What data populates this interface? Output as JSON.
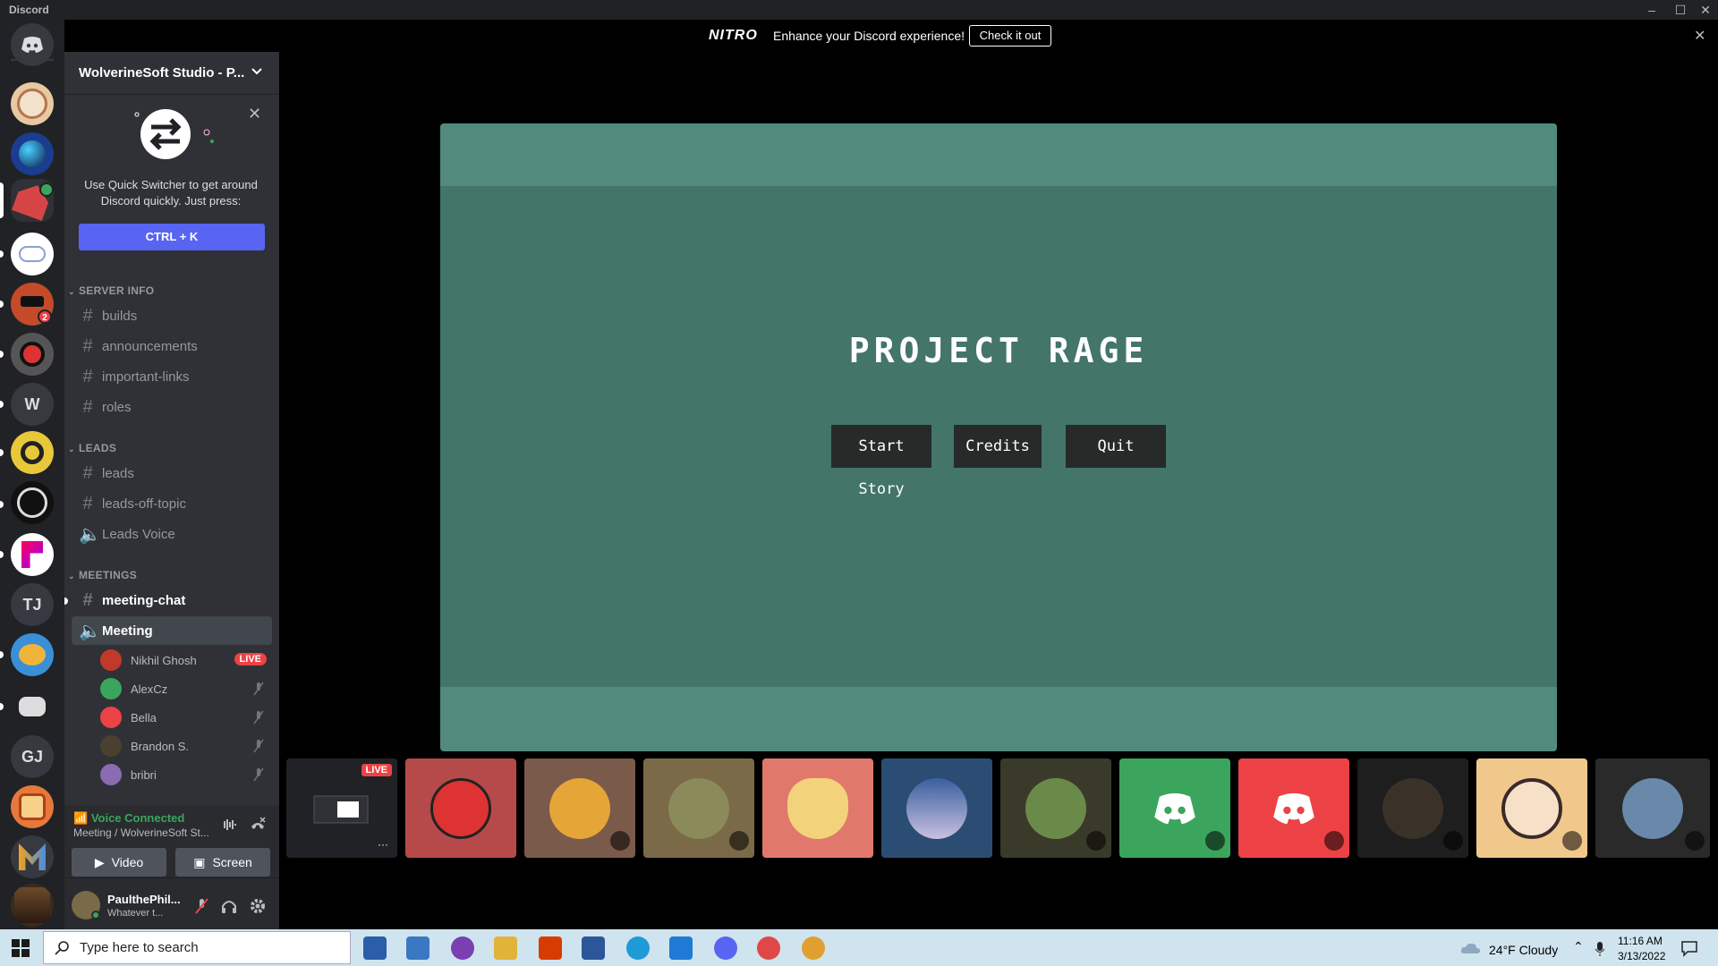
{
  "window": {
    "app_title": "Discord",
    "minimize": "–",
    "maximize": "☐",
    "close": "✕"
  },
  "nitro": {
    "logo": "NITRO",
    "text": "Enhance your Discord experience!",
    "button": "Check it out",
    "close": "✕"
  },
  "rail": {
    "home_icon": "discord-logo-icon",
    "letter_servers": [
      "W",
      "TJ",
      "GJ"
    ],
    "badges": [
      "2"
    ]
  },
  "guild": {
    "name": "WolverineSoft Studio - P...",
    "chevron": "⌄"
  },
  "quick_switcher": {
    "close": "✕",
    "text": "Use Quick Switcher to get around Discord quickly. Just press:",
    "button": "CTRL + K"
  },
  "categories": [
    {
      "name": "SERVER INFO",
      "channels": [
        "builds",
        "announcements",
        "important-links",
        "roles"
      ]
    },
    {
      "name": "LEADS",
      "channels": [
        "leads",
        "leads-off-topic"
      ],
      "voice": [
        "Leads Voice"
      ]
    },
    {
      "name": "MEETINGS",
      "channels": [
        "meeting-chat"
      ],
      "voice": [
        "Meeting"
      ]
    }
  ],
  "voice_users": [
    {
      "name": "Nikhil Ghosh",
      "live": "LIVE",
      "color": "#c0392b"
    },
    {
      "name": "AlexCz",
      "color": "#3ba55d"
    },
    {
      "name": "Bella",
      "color": "#ed4245"
    },
    {
      "name": "Brandon S.",
      "color": "#4a4030"
    },
    {
      "name": "bribri",
      "color": "#8b6bb1"
    }
  ],
  "voice_panel": {
    "status": "Voice Connected",
    "channel": "Meeting / WolverineSoft St...",
    "video": "Video",
    "screen": "Screen"
  },
  "user_panel": {
    "name": "PaulthePhil...",
    "status": "Whatever t..."
  },
  "stream": {
    "title": "PROJECT RAGE",
    "buttons": [
      "Start Story",
      "Credits",
      "Quit"
    ],
    "colors": {
      "outer": "#528b7d",
      "inner": "#437568",
      "button": "#262b2a"
    }
  },
  "tiles": {
    "live_label": "LIVE",
    "more": "···",
    "colors": [
      "#b64a4a",
      "#7a5a4a",
      "#7a6a48",
      "#e0796c",
      "#2b4d73",
      "#3a3a2a",
      "#3ba55d",
      "#ed4245",
      "#1e1e1e",
      "#f1c88c",
      "#2a2a2a"
    ]
  },
  "taskbar": {
    "search_placeholder": "Type here to search",
    "weather": "24°F  Cloudy",
    "time": "11:16 AM",
    "date": "3/13/2022"
  }
}
